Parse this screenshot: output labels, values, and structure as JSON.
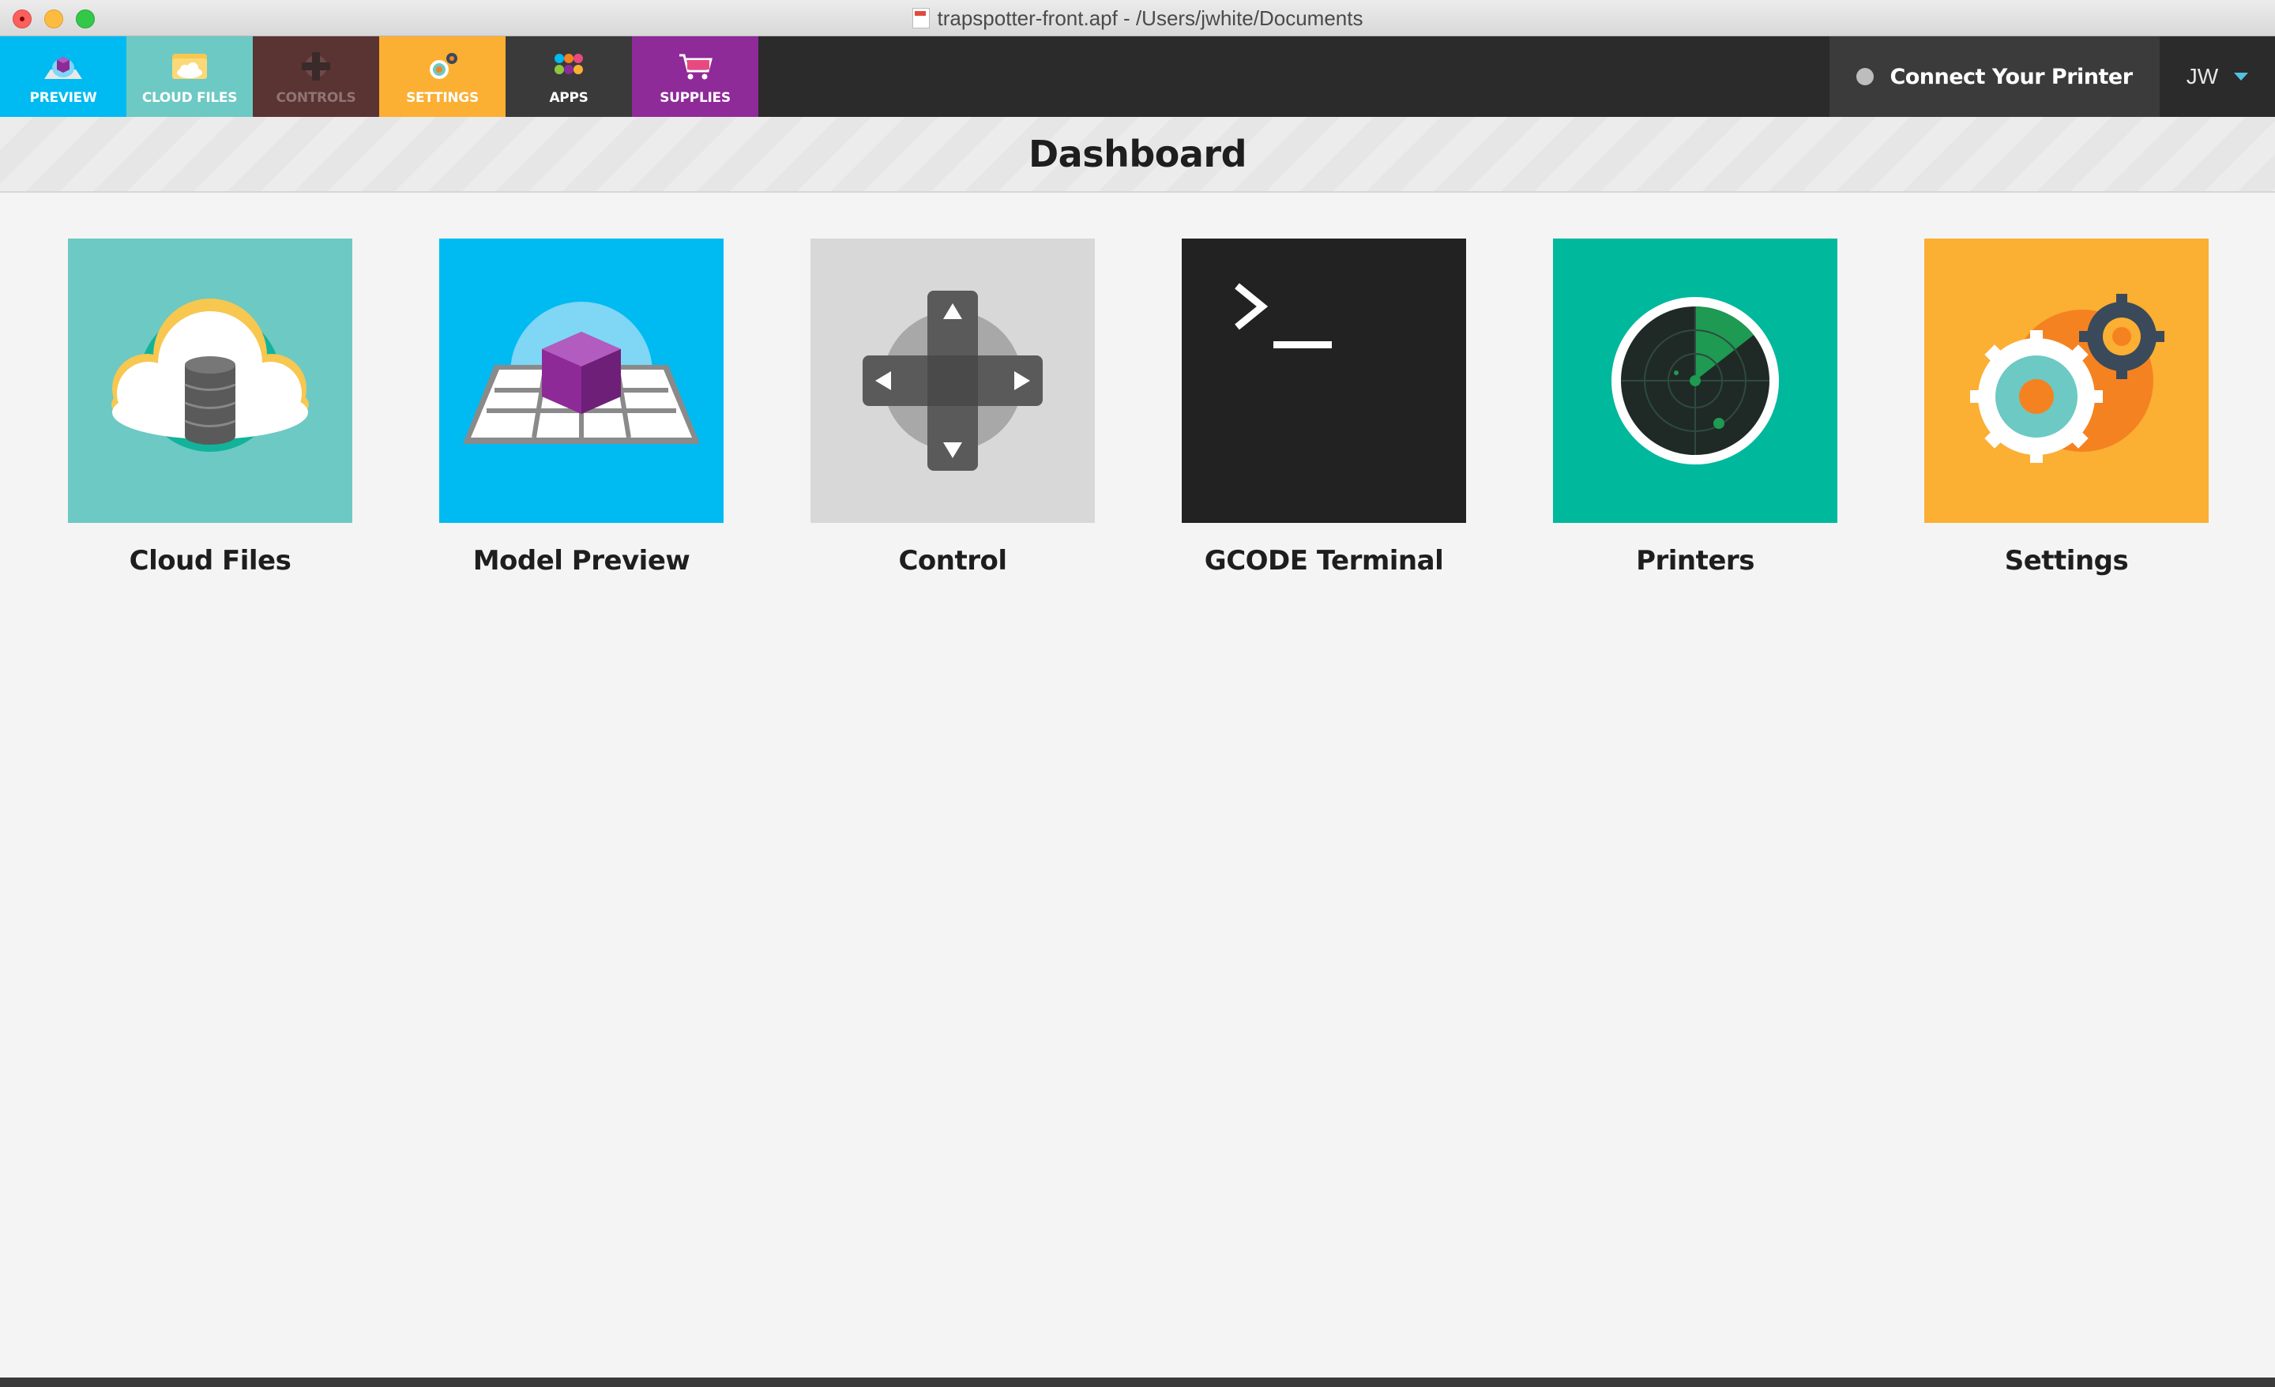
{
  "window": {
    "title": "trapspotter-front.apf - /Users/jwhite/Documents"
  },
  "nav": {
    "tabs": [
      {
        "label": "PREVIEW",
        "icon": "preview-icon",
        "color": "#00baf2"
      },
      {
        "label": "CLOUD FILES",
        "icon": "cloud-files-icon",
        "color": "#6dc9c3"
      },
      {
        "label": "CONTROLS",
        "icon": "controls-icon",
        "color": "#5a3333"
      },
      {
        "label": "SETTINGS",
        "icon": "settings-icon",
        "color": "#fbaf33"
      },
      {
        "label": "APPS",
        "icon": "apps-icon",
        "color": "#3a3a3a"
      },
      {
        "label": "SUPPLIES",
        "icon": "supplies-icon",
        "color": "#8f2a99"
      }
    ],
    "connect_label": "Connect Your Printer",
    "user_initials": "JW"
  },
  "page": {
    "title": "Dashboard"
  },
  "tiles": [
    {
      "label": "Cloud Files",
      "icon": "cloud-database-icon",
      "color": "#6dc9c3"
    },
    {
      "label": "Model Preview",
      "icon": "cube-grid-icon",
      "color": "#00baf2"
    },
    {
      "label": "Control",
      "icon": "dpad-icon",
      "color": "#d8d8d8"
    },
    {
      "label": "GCODE Terminal",
      "icon": "terminal-icon",
      "color": "#222222"
    },
    {
      "label": "Printers",
      "icon": "radar-icon",
      "color": "#00b89c"
    },
    {
      "label": "Settings",
      "icon": "gears-icon",
      "color": "#fbaf33"
    }
  ]
}
